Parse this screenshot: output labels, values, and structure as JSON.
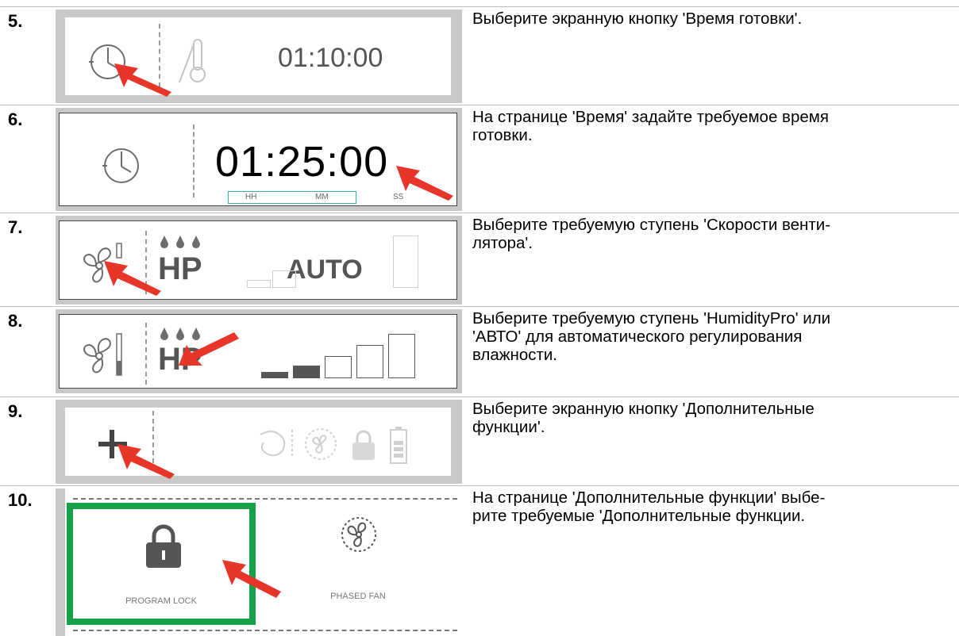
{
  "steps": [
    {
      "number": "5.",
      "text_lines": [
        "Выберите экранную кнопку 'Время готовки'."
      ],
      "screen": {
        "time": "01:10:00"
      }
    },
    {
      "number": "6.",
      "text_lines": [
        "На странице 'Время' задайте требуемое время",
        "готовки."
      ],
      "screen": {
        "time": "01:25:00",
        "hh": "HH",
        "mm": "MM",
        "ss": "SS"
      }
    },
    {
      "number": "7.",
      "text_lines": [
        "Выберите требуемую ступень 'Скорости венти-",
        "лятора'."
      ],
      "screen": {
        "hp": "HP",
        "auto": "AUTO"
      }
    },
    {
      "number": "8.",
      "text_lines": [
        "Выберите требуемую ступень 'HumidityPro' или",
        "'АВТО' для автоматического регулирования",
        "влажности."
      ],
      "screen": {
        "hp": "HP"
      }
    },
    {
      "number": "9.",
      "text_lines": [
        "Выберите экранную кнопку 'Дополнительные",
        "функции'."
      ],
      "screen": {}
    },
    {
      "number": "10.",
      "text_lines": [
        "На странице 'Дополнительные функции' выбе-",
        "рите требуемые 'Дополнительные функции."
      ],
      "screen": {
        "left_label": "PROGRAM LOCK",
        "right_label": "PHASED FAN"
      }
    }
  ],
  "colors": {
    "arrow": "#e8352a",
    "highlight": "#17a04a",
    "frame": "#c9c9c9",
    "icon": "#6d6d6d"
  },
  "icons": [
    "clock-icon",
    "thermometer-icon",
    "fan-icon",
    "humidity-drops-icon",
    "plus-icon",
    "steam-icon",
    "lock-icon",
    "battery-icon",
    "red-arrow"
  ]
}
